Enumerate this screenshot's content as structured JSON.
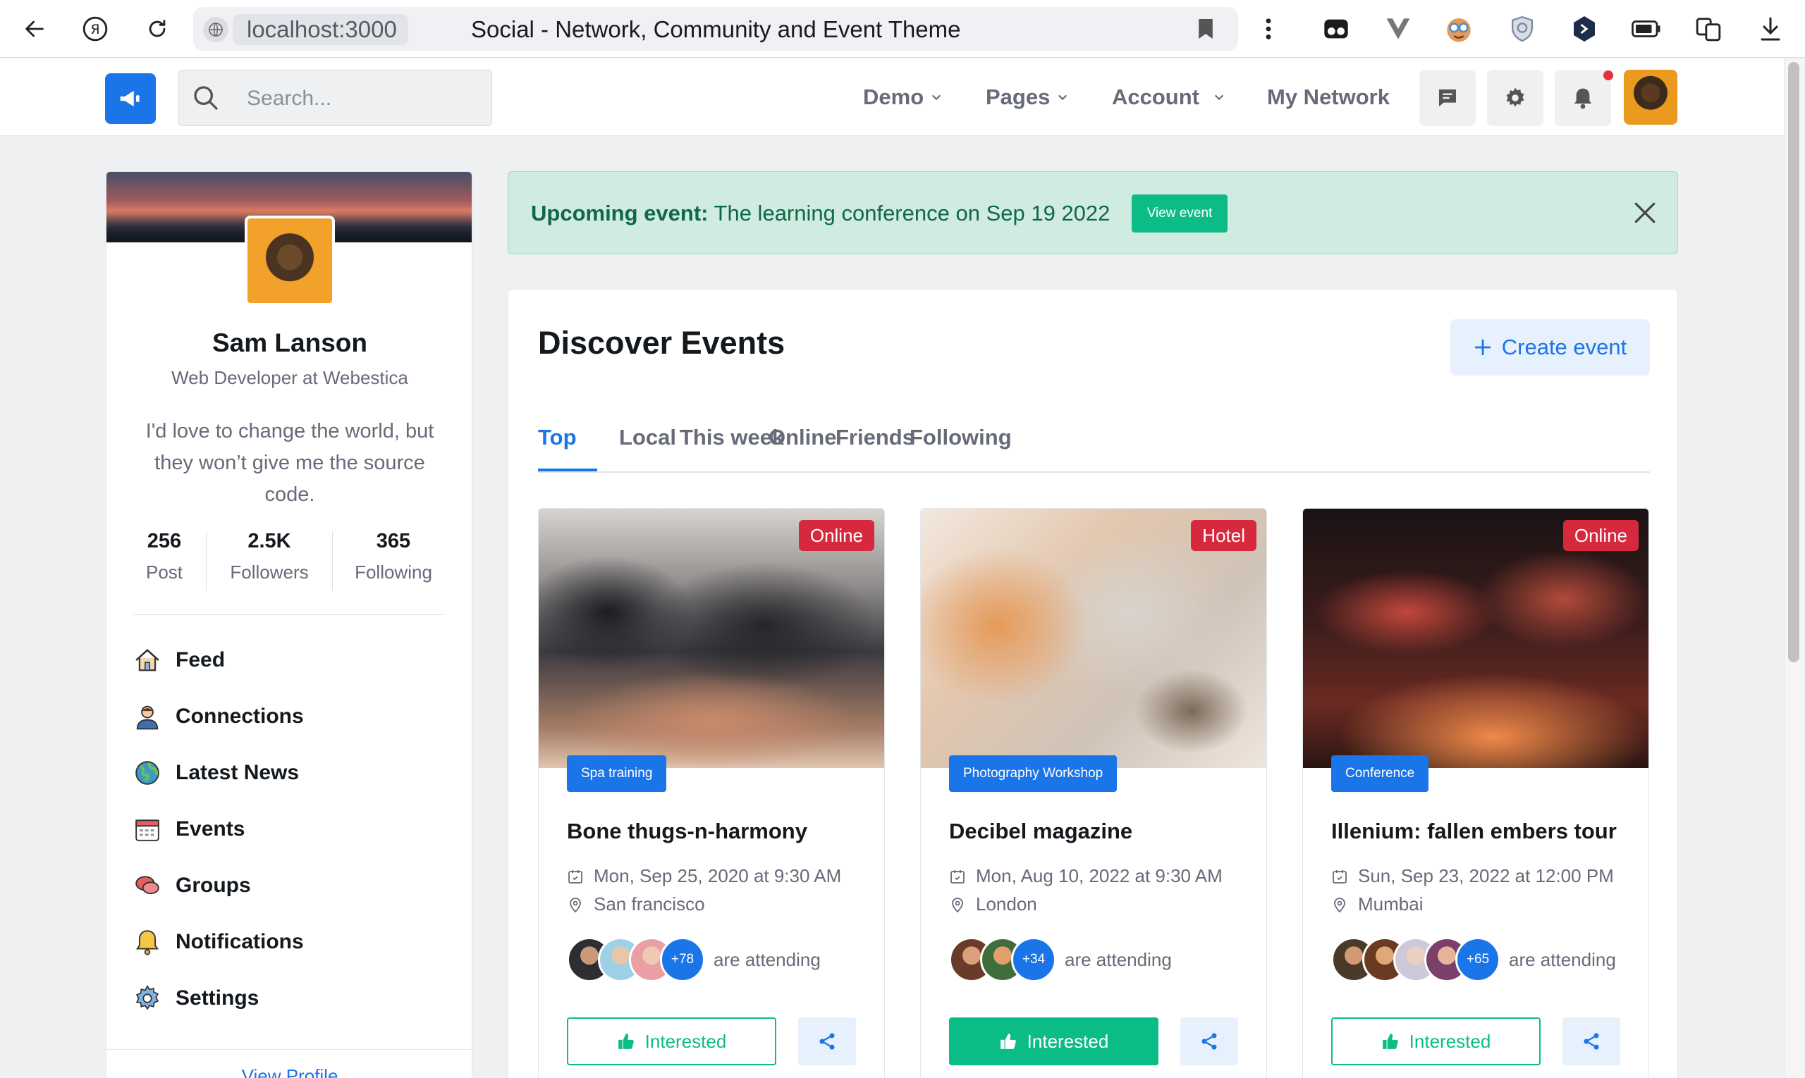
{
  "browser": {
    "url": "localhost:3000",
    "page_title": "Social - Network, Community and Event Theme"
  },
  "header": {
    "search_placeholder": "Search...",
    "nav": {
      "demo": "Demo",
      "pages": "Pages",
      "account": "Account",
      "my_network": "My Network"
    }
  },
  "profile": {
    "name": "Sam Lanson",
    "role": "Web Developer at Webestica",
    "quote": "I'd love to change the world, but they won’t give me the source code.",
    "stats": [
      {
        "value": "256",
        "label": "Post"
      },
      {
        "value": "2.5K",
        "label": "Followers"
      },
      {
        "value": "365",
        "label": "Following"
      }
    ],
    "menu": [
      {
        "label": "Feed",
        "icon": "home-icon"
      },
      {
        "label": "Connections",
        "icon": "person-icon"
      },
      {
        "label": "Latest News",
        "icon": "globe-icon"
      },
      {
        "label": "Events",
        "icon": "calendar-icon"
      },
      {
        "label": "Groups",
        "icon": "chat-bubbles-icon"
      },
      {
        "label": "Notifications",
        "icon": "bell-icon"
      },
      {
        "label": "Settings",
        "icon": "gear-icon"
      }
    ],
    "view_profile": "View Profile"
  },
  "banner": {
    "label": "Upcoming event:",
    "text": "The learning conference on Sep 19 2022",
    "button": "View event"
  },
  "events": {
    "title": "Discover Events",
    "create_button": "Create event",
    "tabs": [
      "Top",
      "Local",
      "This week",
      "Online",
      "Friends",
      "Following"
    ],
    "active_tab": "Top",
    "cards": [
      {
        "badge": "Online",
        "category": "Spa training",
        "title": "Bone thugs-n-harmony",
        "date": "Mon, Sep 25, 2020 at 9:30 AM",
        "location": "San francisco",
        "more_count": "+78",
        "attending_text": "are attending",
        "interested": "Interested",
        "interested_active": false
      },
      {
        "badge": "Hotel",
        "category": "Photography Workshop",
        "title": "Decibel magazine",
        "date": "Mon, Aug 10, 2022 at 9:30 AM",
        "location": "London",
        "more_count": "+34",
        "attending_text": "are attending",
        "interested": "Interested",
        "interested_active": true
      },
      {
        "badge": "Online",
        "category": "Conference",
        "title": "Illenium: fallen embers tour",
        "date": "Sun, Sep 23, 2022 at 12:00 PM",
        "location": "Mumbai",
        "more_count": "+65",
        "attending_text": "are attending",
        "interested": "Interested",
        "interested_active": false
      }
    ]
  },
  "colors": {
    "primary": "#1a75e8",
    "success": "#0cbc87",
    "danger": "#d6293e",
    "muted": "#676a79"
  }
}
